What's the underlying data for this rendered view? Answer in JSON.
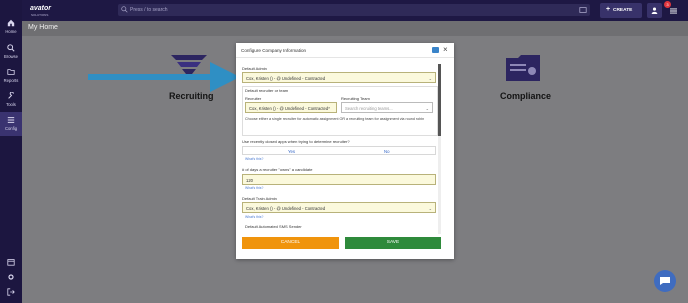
{
  "sidebar": {
    "items": [
      {
        "label": "Home",
        "icon": "home-icon"
      },
      {
        "label": "Browse",
        "icon": "search-icon"
      },
      {
        "label": "Reports",
        "icon": "folder-icon"
      },
      {
        "label": "Tools",
        "icon": "tools-icon"
      },
      {
        "label": "Config",
        "icon": "config-icon"
      }
    ],
    "bottom_icons": [
      "calendar-icon",
      "settings-icon",
      "logout-icon"
    ]
  },
  "header": {
    "logo": "avator",
    "logo_sub": "SOLUTIONS",
    "search_placeholder": "Press / to search",
    "create_label": "CREATE",
    "notification_count": "3"
  },
  "breadcrumb": "My Home",
  "dashboard": {
    "tiles": [
      {
        "label": "Recruiting"
      },
      {
        "label": "Compliance"
      }
    ]
  },
  "modal": {
    "title": "Configure Company Information",
    "default_admin": {
      "label": "Default Admin",
      "value": "Cox, Kristen () - @ Undefined - Contracted"
    },
    "recruiter_group": {
      "legend": "Default recruiter or team",
      "recruiter_label": "Recruiter",
      "recruiter_value": "Cox, Kristen () - @ Undefined - Contracted*",
      "team_label": "Recruiting Team",
      "team_placeholder": "Search recruiting teams...",
      "note": "Choose either a single recruiter for automatic assignment OR a recruiting team for assignment via round robin"
    },
    "closed_apps": {
      "label": "Use recently closed apps when trying to determine recruiter?",
      "yes": "Yes",
      "no": "No",
      "help": "What's this?"
    },
    "days_owns": {
      "label": "# of days a recruiter \"owns\" a candidate",
      "value": "120",
      "help": "What's this?"
    },
    "train_admin": {
      "label": "Default Train Admin",
      "value": "Cox, Kristen () - @ Undefined - Contracted",
      "help": "What's this?"
    },
    "sms_sender_label": "Default Automated SMS Sender",
    "cancel_label": "CANCEL",
    "save_label": "SAVE"
  },
  "colors": {
    "sidebar": "#1c1640",
    "accent_arrow": "#2f8fc4",
    "cancel": "#f0940c",
    "save": "#2e8a3b",
    "field_highlight": "#fbf9dc"
  }
}
